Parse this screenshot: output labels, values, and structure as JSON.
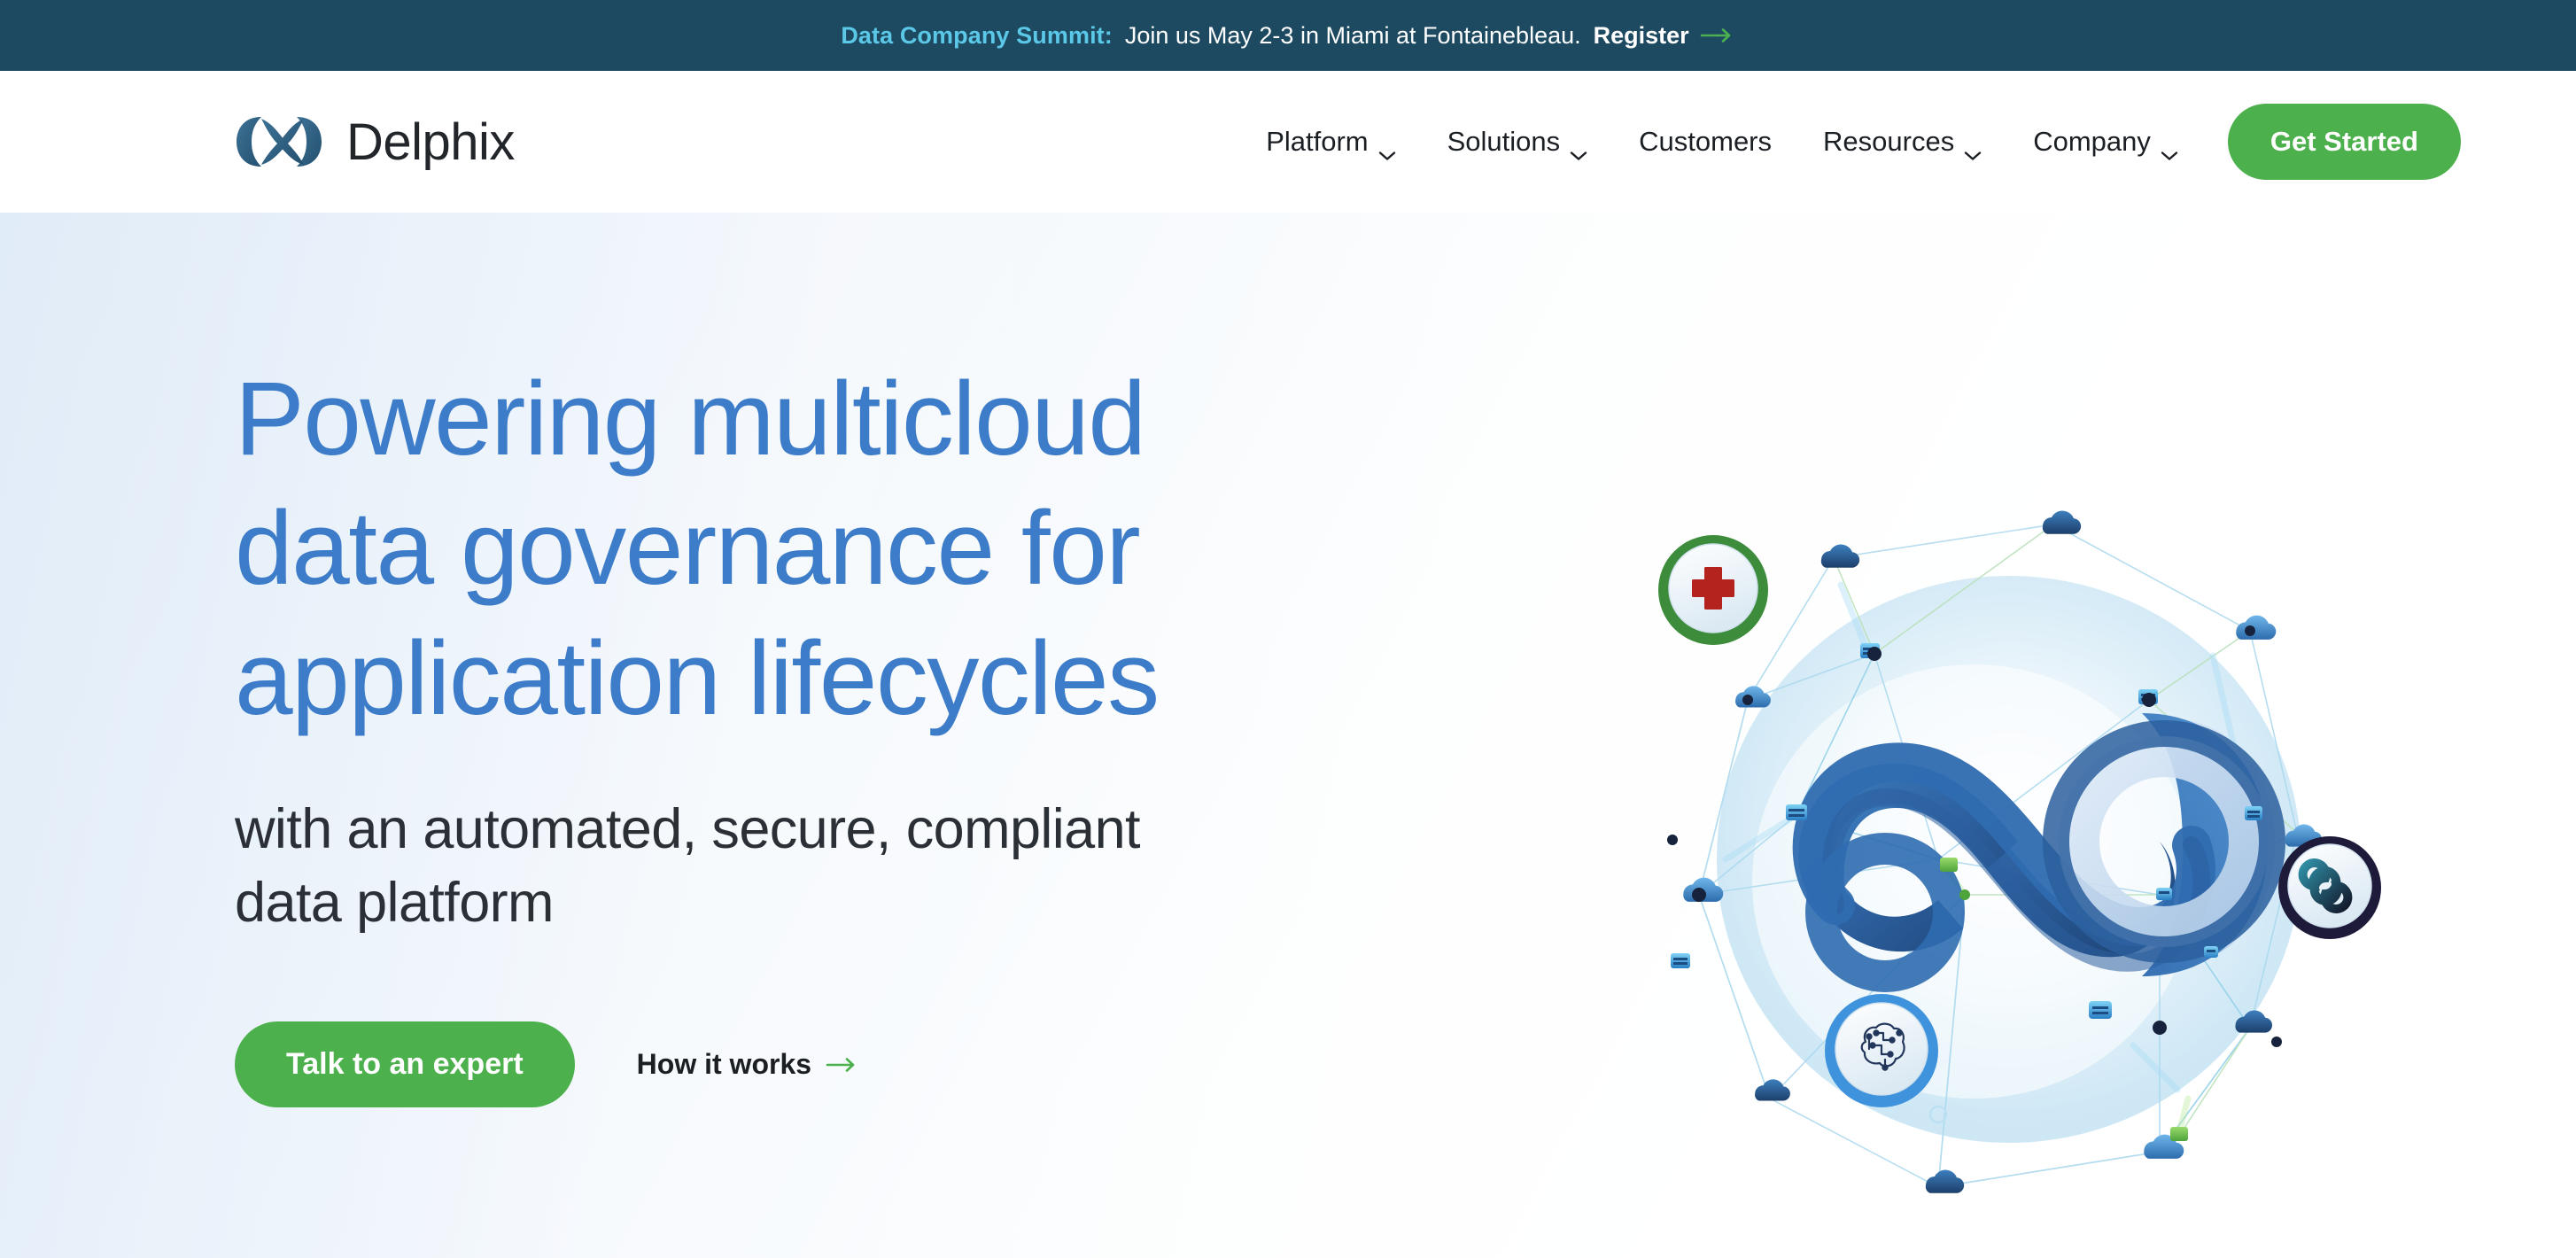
{
  "banner": {
    "highlight": "Data Company Summit:",
    "text": "Join us May 2-3 in Miami at Fontainebleau.",
    "register_label": "Register",
    "arrow_icon": "arrow-right-icon",
    "background_color": "#1d4a61",
    "highlight_color": "#5bc8e8",
    "arrow_color": "#4caf50"
  },
  "header": {
    "logo": {
      "wordmark": "Delphix",
      "mark_icon": "delphix-infinity-logo-icon",
      "mark_color": "#2f6388",
      "wordmark_color": "#22262b"
    },
    "nav": [
      {
        "label": "Platform",
        "has_dropdown": true,
        "icon": "chevron-down-icon"
      },
      {
        "label": "Solutions",
        "has_dropdown": true,
        "icon": "chevron-down-icon"
      },
      {
        "label": "Customers",
        "has_dropdown": false,
        "icon": ""
      },
      {
        "label": "Resources",
        "has_dropdown": true,
        "icon": "chevron-down-icon"
      },
      {
        "label": "Company",
        "has_dropdown": true,
        "icon": "chevron-down-icon"
      }
    ],
    "cta_label": "Get Started",
    "cta_color": "#4cb04c"
  },
  "hero": {
    "headline_lines": [
      "Powering multicloud",
      "data governance for",
      "application lifecycles"
    ],
    "headline_color": "#3d7cc9",
    "subhead_lines": [
      "with an automated, secure, compliant",
      "data platform"
    ],
    "primary_cta": "Talk to an expert",
    "secondary_cta": "How it works",
    "secondary_cta_icon": "arrow-right-icon",
    "primary_cta_color": "#4cb04c",
    "secondary_arrow_color": "#4cb04c"
  },
  "illustration": {
    "name": "multicloud-data-network-illustration",
    "center_mark": "delphix-infinity-logo-icon",
    "badges": [
      {
        "name": "healthcare-cross-badge",
        "icon": "red-cross-icon",
        "ring_color": "#3c8c3c",
        "glyph_color": "#b5231f"
      },
      {
        "name": "infinity-badge",
        "icon": "infinity-icon",
        "ring_color": "#1e1b3a",
        "glyph_color": "#1b7f93"
      },
      {
        "name": "ai-brain-badge",
        "icon": "ai-brain-circuit-icon",
        "ring_color": "#3f93dd",
        "glyph_color": "#23375c"
      }
    ],
    "node_icons": [
      "cloud-icon",
      "server-cube-icon",
      "network-dot-icon"
    ],
    "link_colors": [
      "#9ed6ef",
      "#b6e3b6"
    ]
  }
}
